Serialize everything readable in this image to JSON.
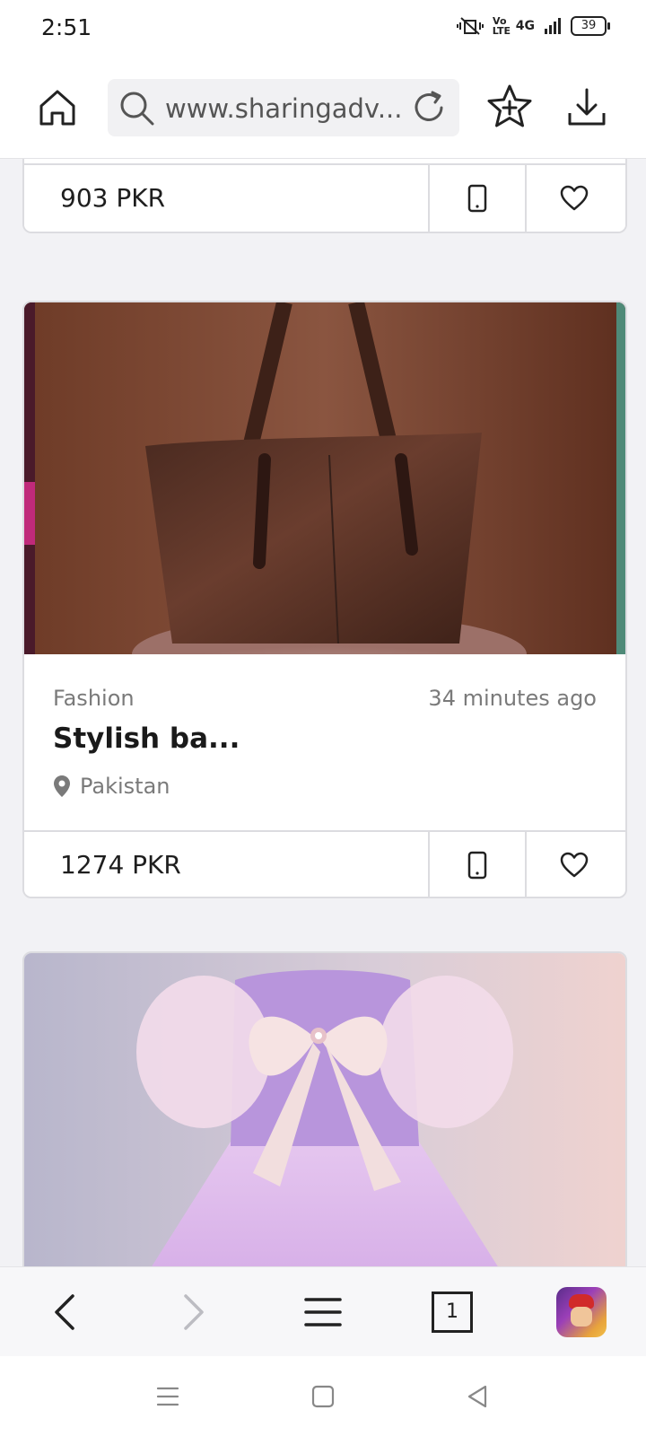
{
  "status": {
    "time": "2:51",
    "battery": "39",
    "network": "4G",
    "volte": "Vo LTE"
  },
  "toolbar": {
    "url": "www.sharingadv...",
    "icons": [
      "home-icon",
      "search-icon",
      "reload-icon",
      "bookmark-add-icon",
      "download-icon"
    ]
  },
  "listings": [
    {
      "price": "903 PKR"
    },
    {
      "category": "Fashion",
      "posted": "34 minutes ago",
      "title": "Stylish ba...",
      "location": "Pakistan",
      "price": "1274 PKR",
      "image": "brown-leather-tote-bag"
    },
    {
      "image": "lavender-girls-dress-with-bow"
    }
  ],
  "bottom_nav": {
    "tab_count": "1",
    "icons": [
      "back-icon",
      "forward-icon",
      "menu-icon",
      "tabs-icon",
      "game-app-icon"
    ]
  },
  "system_nav": {
    "icons": [
      "recents-icon",
      "home-square-icon",
      "back-triangle-icon"
    ]
  },
  "colors": {
    "card_border": "#dcdce0",
    "page_bg": "#f2f2f5",
    "muted_text": "#7a7a7a"
  }
}
